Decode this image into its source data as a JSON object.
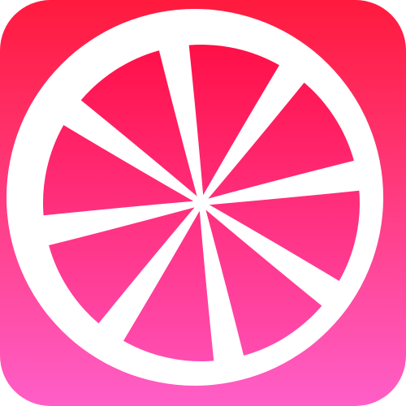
{
  "icon": {
    "name": "grapefruit-slice-icon",
    "colors": {
      "background_top": "#ff1a3d",
      "background_bottom": "#ff5ec8",
      "rind": "#ffffff",
      "segment_top": "#ff0f45",
      "segment_bottom": "#ff4cb0"
    },
    "segment_count": 8
  }
}
